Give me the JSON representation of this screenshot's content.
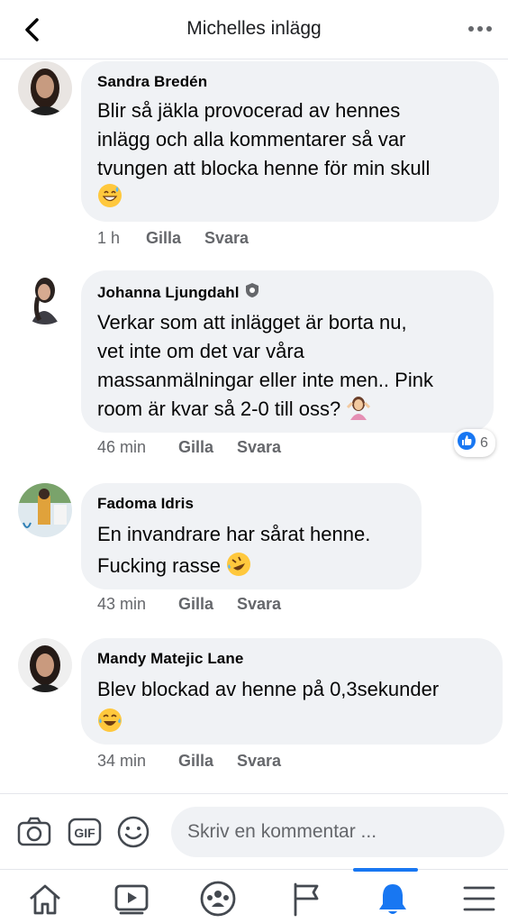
{
  "header": {
    "title": "Michelles inlägg"
  },
  "comments": [
    {
      "author": "Sandra Bredén",
      "lines": [
        "Blir så jäkla provocerad av hennes",
        "inlägg och alla kommentarer så var",
        "tvungen att blocka henne för min skull"
      ],
      "emoji": "grinning-sweat-emoji",
      "time": "1 h",
      "like": "Gilla",
      "reply": "Svara"
    },
    {
      "author": "Johanna Ljungdahl",
      "badge": "shield-badge-icon",
      "lines": [
        "Verkar som att inlägget är borta nu,",
        "vet inte om det var våra",
        "massanmälningar eller inte men.. Pink",
        "room är kvar så 2-0 till oss?"
      ],
      "emoji": "woman-shrugging-emoji",
      "time": "46 min",
      "like": "Gilla",
      "reply": "Svara",
      "reaction_count": "6",
      "reaction_icon": "like-reaction-icon"
    },
    {
      "author": "Fadoma Idris",
      "lines": [
        "En invandrare har sårat henne.",
        "Fucking rasse"
      ],
      "emoji": "rolling-laughing-emoji",
      "time": "43 min",
      "like": "Gilla",
      "reply": "Svara"
    },
    {
      "author": "Mandy Matejic Lane",
      "lines": [
        "Blev blockad av henne på 0,3sekunder"
      ],
      "emoji": "tears-of-joy-emoji",
      "time": "34 min",
      "like": "Gilla",
      "reply": "Svara"
    }
  ],
  "composer": {
    "placeholder": "Skriv en kommentar ..."
  },
  "colors": {
    "accent": "#1877f2",
    "bubble": "#f0f2f5",
    "meta": "#65676b"
  }
}
